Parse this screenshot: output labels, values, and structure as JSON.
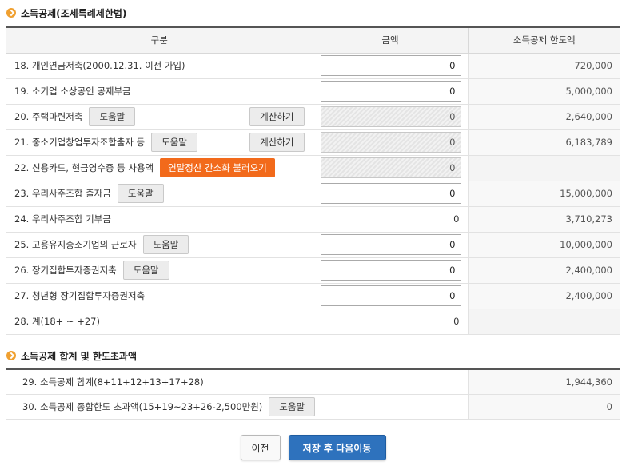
{
  "section1": {
    "title": "소득공제(조세특례제한법)"
  },
  "table": {
    "headers": [
      "구분",
      "금액",
      "소득공제 한도액"
    ],
    "rows": [
      {
        "label": "18. 개인연금저축(2000.12.31. 이전 가입)",
        "amount": "0",
        "limit": "720,000"
      },
      {
        "label": "19. 소기업 소상공인 공제부금",
        "amount": "0",
        "limit": "5,000,000"
      },
      {
        "label": "20. 주택마련저축",
        "help": "도움말",
        "calc": "계산하기",
        "amount": "0",
        "limit": "2,640,000"
      },
      {
        "label": "21. 중소기업창업투자조합출자 등",
        "help": "도움말",
        "calc": "계산하기",
        "amount": "0",
        "limit": "6,183,789"
      },
      {
        "label": "22. 신용카드, 현금영수증 등 사용액",
        "action": "연말정산 간소화 불러오기",
        "amount": "0",
        "limit": ""
      },
      {
        "label": "23. 우리사주조합 출자금",
        "help": "도움말",
        "amount": "0",
        "limit": "15,000,000"
      },
      {
        "label": "24. 우리사주조합 기부금",
        "amount": "0",
        "limit": "3,710,273"
      },
      {
        "label": "25. 고용유지중소기업의 근로자",
        "help": "도움말",
        "amount": "0",
        "limit": "10,000,000"
      },
      {
        "label": "26. 장기집합투자증권저축",
        "help": "도움말",
        "amount": "0",
        "limit": "2,400,000"
      },
      {
        "label": "27. 청년형 장기집합투자증권저축",
        "amount": "0",
        "limit": "2,400,000"
      },
      {
        "label": "28. 계(18+ ~ +27)",
        "amount": "0",
        "limit": ""
      }
    ]
  },
  "section2": {
    "title": "소득공제 합계 및 한도초과액"
  },
  "summary": {
    "rows": [
      {
        "label": "29. 소득공제 합계(8+11+12+13+17+28)",
        "value": "1,944,360"
      },
      {
        "label": "30. 소득공제 종합한도 초과액(15+19~23+26-2,500만원)",
        "help": "도움말",
        "value": "0"
      }
    ]
  },
  "footer": {
    "prev_label": "이전",
    "next_label": "저장 후 다음이동"
  },
  "colors": {
    "accent_orange": "#f26a1b",
    "primary_blue": "#2e72bd",
    "bullet": "#f0a030"
  }
}
